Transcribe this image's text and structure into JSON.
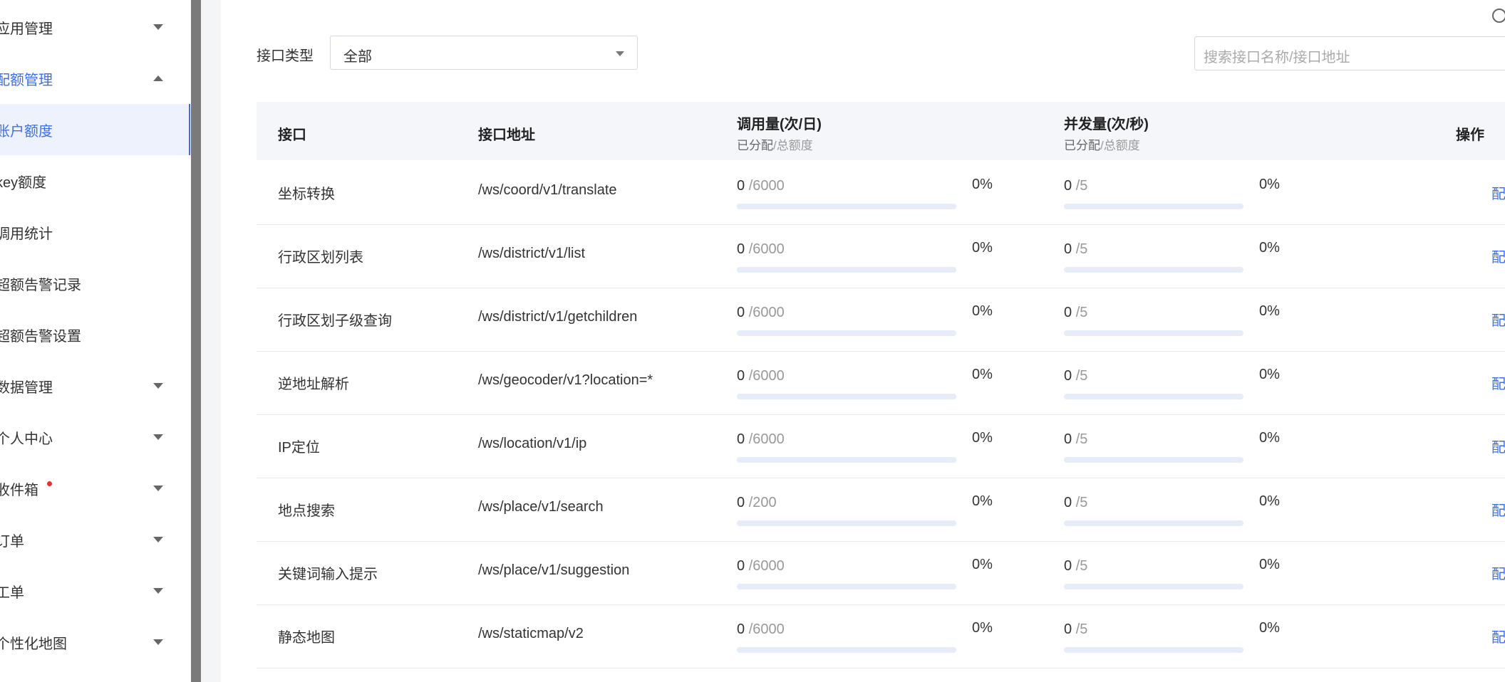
{
  "sidebar": {
    "items": [
      {
        "label": "应用管理",
        "caret": "down"
      },
      {
        "label": "配额管理",
        "caret": "up",
        "active": true
      },
      {
        "label": "账户额度",
        "selected": true
      },
      {
        "label": "key额度"
      },
      {
        "label": "调用统计"
      },
      {
        "label": "超额告警记录"
      },
      {
        "label": "超额告警设置"
      },
      {
        "label": "数据管理",
        "caret": "down"
      },
      {
        "label": "个人中心",
        "caret": "down"
      },
      {
        "label": "收件箱",
        "caret": "down",
        "badge": true
      },
      {
        "label": "订单",
        "caret": "down"
      },
      {
        "label": "工单",
        "caret": "down"
      },
      {
        "label": "个性化地图",
        "caret": "down"
      }
    ]
  },
  "filter": {
    "label": "接口类型",
    "selected": "全部",
    "search_placeholder": "搜索接口名称/接口地址"
  },
  "table": {
    "headers": {
      "name": "接口",
      "path": "接口地址",
      "calls": "调用量(次/日)",
      "concurrency": "并发量(次/秒)",
      "allocated": "已分配",
      "total_sep": "/总额度",
      "action": "操作"
    },
    "rows": [
      {
        "name": "坐标转换",
        "path": "/ws/coord/v1/translate",
        "calls_used": "0",
        "calls_total": "/6000",
        "calls_pct": "0%",
        "calls_fill": 0,
        "conc_used": "0",
        "conc_total": "/5",
        "conc_pct": "0%",
        "conc_fill": 0,
        "action": "配额分配"
      },
      {
        "name": "行政区划列表",
        "path": "/ws/district/v1/list",
        "calls_used": "0",
        "calls_total": "/6000",
        "calls_pct": "0%",
        "calls_fill": 0,
        "conc_used": "0",
        "conc_total": "/5",
        "conc_pct": "0%",
        "conc_fill": 0,
        "action": "配额分配"
      },
      {
        "name": "行政区划子级查询",
        "path": "/ws/district/v1/getchildren",
        "calls_used": "0",
        "calls_total": "/6000",
        "calls_pct": "0%",
        "calls_fill": 0,
        "conc_used": "0",
        "conc_total": "/5",
        "conc_pct": "0%",
        "conc_fill": 0,
        "action": "配额分配"
      },
      {
        "name": "逆地址解析",
        "path": "/ws/geocoder/v1?location=*",
        "calls_used": "0",
        "calls_total": "/6000",
        "calls_pct": "0%",
        "calls_fill": 0,
        "conc_used": "0",
        "conc_total": "/5",
        "conc_pct": "0%",
        "conc_fill": 0,
        "action": "配额分配"
      },
      {
        "name": "IP定位",
        "path": "/ws/location/v1/ip",
        "calls_used": "0",
        "calls_total": "/6000",
        "calls_pct": "0%",
        "calls_fill": 0,
        "conc_used": "0",
        "conc_total": "/5",
        "conc_pct": "0%",
        "conc_fill": 0,
        "action": "配额分配"
      },
      {
        "name": "地点搜索",
        "path": "/ws/place/v1/search",
        "calls_used": "0",
        "calls_total": "/200",
        "calls_pct": "0%",
        "calls_fill": 0,
        "conc_used": "0",
        "conc_total": "/5",
        "conc_pct": "0%",
        "conc_fill": 0,
        "action": "配额分配"
      },
      {
        "name": "关键词输入提示",
        "path": "/ws/place/v1/suggestion",
        "calls_used": "0",
        "calls_total": "/6000",
        "calls_pct": "0%",
        "calls_fill": 0,
        "conc_used": "0",
        "conc_total": "/5",
        "conc_pct": "0%",
        "conc_fill": 0,
        "action": "配额分配"
      },
      {
        "name": "静态地图",
        "path": "/ws/staticmap/v2",
        "calls_used": "0",
        "calls_total": "/6000",
        "calls_pct": "0%",
        "calls_fill": 0,
        "conc_used": "0",
        "conc_total": "/5",
        "conc_pct": "0%",
        "conc_fill": 0,
        "action": "配额分配"
      }
    ]
  },
  "colors": {
    "accent": "#3d6fe8",
    "badge": "#e5332f",
    "bar_track": "#e6ecf8"
  }
}
